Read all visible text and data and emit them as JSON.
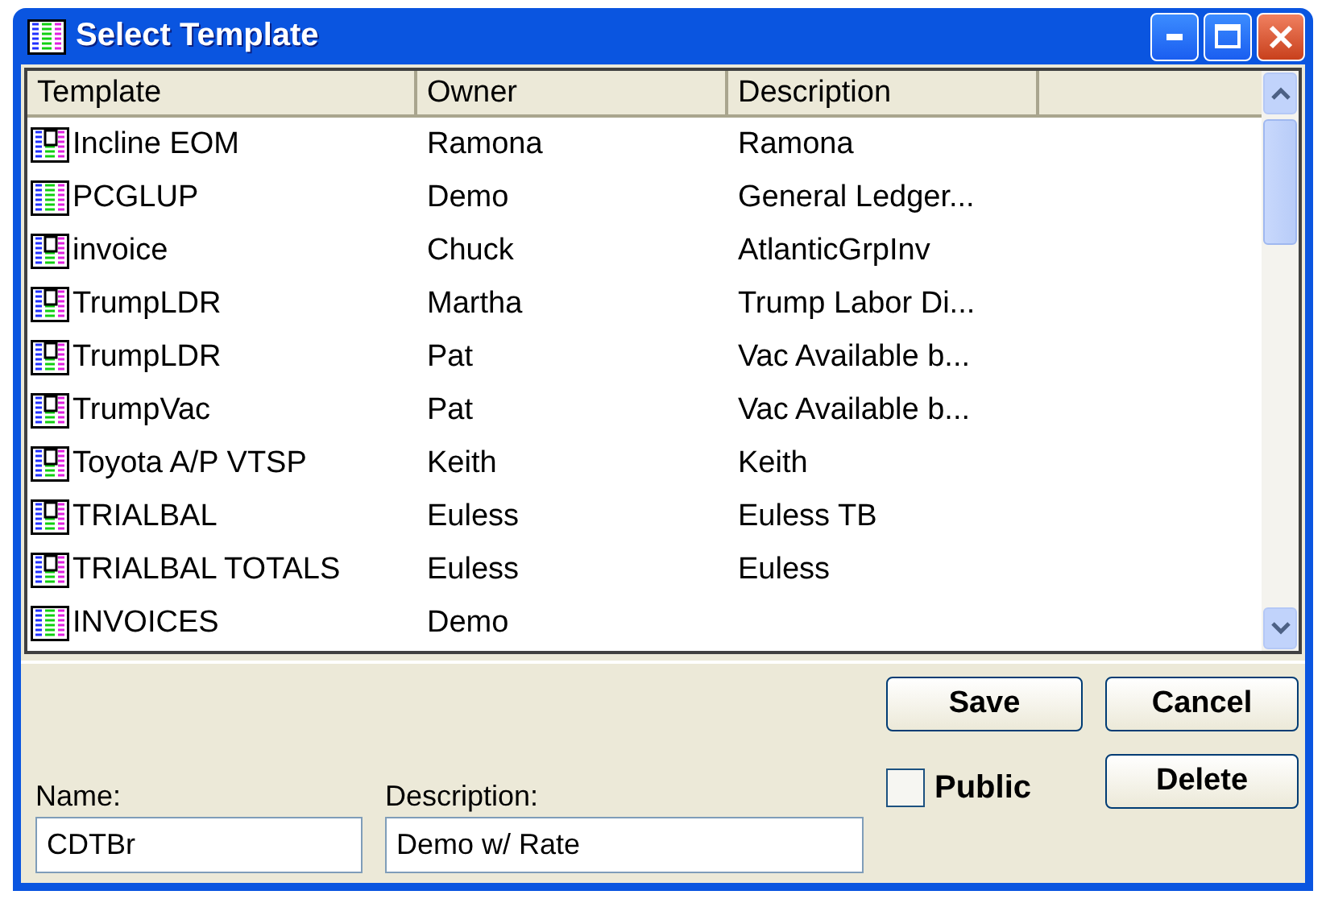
{
  "window": {
    "title": "Select Template"
  },
  "table": {
    "columns": [
      "Template",
      "Owner",
      "Description"
    ],
    "rows": [
      {
        "kind": "report",
        "template": "Incline EOM",
        "owner": "Ramona",
        "description": "Ramona"
      },
      {
        "kind": "list",
        "template": "PCGLUP",
        "owner": "Demo",
        "description": "General Ledger..."
      },
      {
        "kind": "report",
        "template": "invoice",
        "owner": "Chuck",
        "description": "AtlanticGrpInv"
      },
      {
        "kind": "report",
        "template": "TrumpLDR",
        "owner": "Martha",
        "description": "Trump Labor Di..."
      },
      {
        "kind": "report",
        "template": "TrumpLDR",
        "owner": "Pat",
        "description": "Vac Available b..."
      },
      {
        "kind": "report",
        "template": "TrumpVac",
        "owner": "Pat",
        "description": "Vac Available b..."
      },
      {
        "kind": "report",
        "template": "Toyota A/P VTSP",
        "owner": "Keith",
        "description": "Keith"
      },
      {
        "kind": "report",
        "template": "TRIALBAL",
        "owner": "Euless",
        "description": "Euless TB"
      },
      {
        "kind": "report",
        "template": "TRIALBAL TOTALS",
        "owner": "Euless",
        "description": "Euless"
      },
      {
        "kind": "list",
        "template": "INVOICES",
        "owner": "Demo",
        "description": ""
      }
    ]
  },
  "form": {
    "name": {
      "label": "Name:",
      "value": "CDTBr"
    },
    "description": {
      "label": "Description:",
      "value": "Demo w/ Rate"
    },
    "public": {
      "label": "Public",
      "checked": false
    }
  },
  "buttons": [
    "Save",
    "Cancel",
    "Delete"
  ]
}
